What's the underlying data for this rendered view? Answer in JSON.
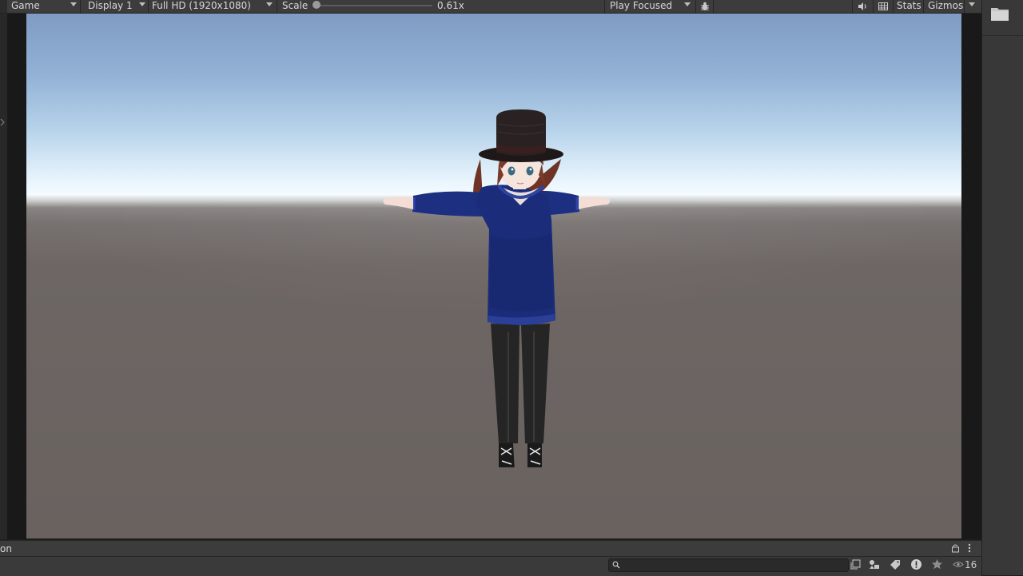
{
  "toolbar": {
    "view_tab": "Game",
    "display": "Display 1",
    "resolution": "Full HD (1920x1080)",
    "scale_label": "Scale",
    "scale_value": "0.61x",
    "play_mode": "Play Focused",
    "stats_label": "Stats",
    "gizmos_label": "Gizmos"
  },
  "bottom": {
    "panel_tab_label": "on",
    "visible_count": "16"
  },
  "icons": {
    "mute": "speaker-icon",
    "bug": "bug-icon",
    "grid": "grid-icon",
    "folder": "folder-icon",
    "lock": "lock-icon",
    "more": "kebab-menu-icon",
    "search": "search-icon",
    "eye": "eye-icon"
  },
  "colors": {
    "toolbar_bg": "#3c3c3c",
    "sky_top": "#7f9bc3",
    "horizon": "#f5fbff",
    "ground": "#69625f",
    "hoodie": "#1c2f7e"
  }
}
